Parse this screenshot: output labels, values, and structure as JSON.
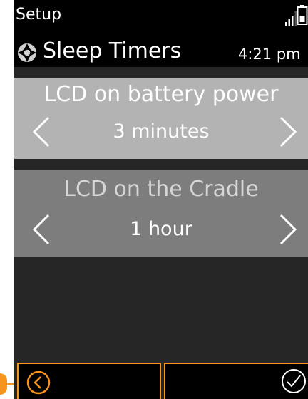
{
  "status_bar": {
    "title": "Setup",
    "icons": [
      "signal-icon",
      "battery-icon"
    ]
  },
  "header": {
    "icon": "gear-icon",
    "title": "Sleep Timers",
    "time": "4:21 pm"
  },
  "settings": [
    {
      "label": "LCD on battery power",
      "value": "3 minutes",
      "icons": [
        "chevron-left-icon",
        "chevron-right-icon"
      ]
    },
    {
      "label": "LCD on the Cradle",
      "value": "1 hour",
      "icons": [
        "chevron-left-icon",
        "chevron-right-icon"
      ]
    }
  ],
  "softkeys": {
    "left_icon": "back-icon",
    "right_icon": "check-icon"
  },
  "colors": {
    "accent": "#f7941d",
    "screen_background": "#262626",
    "bar_background": "#000000",
    "panel_selected": "#b3b3b3",
    "panel_unselected": "#7d7d7d",
    "text": "#ffffff"
  }
}
